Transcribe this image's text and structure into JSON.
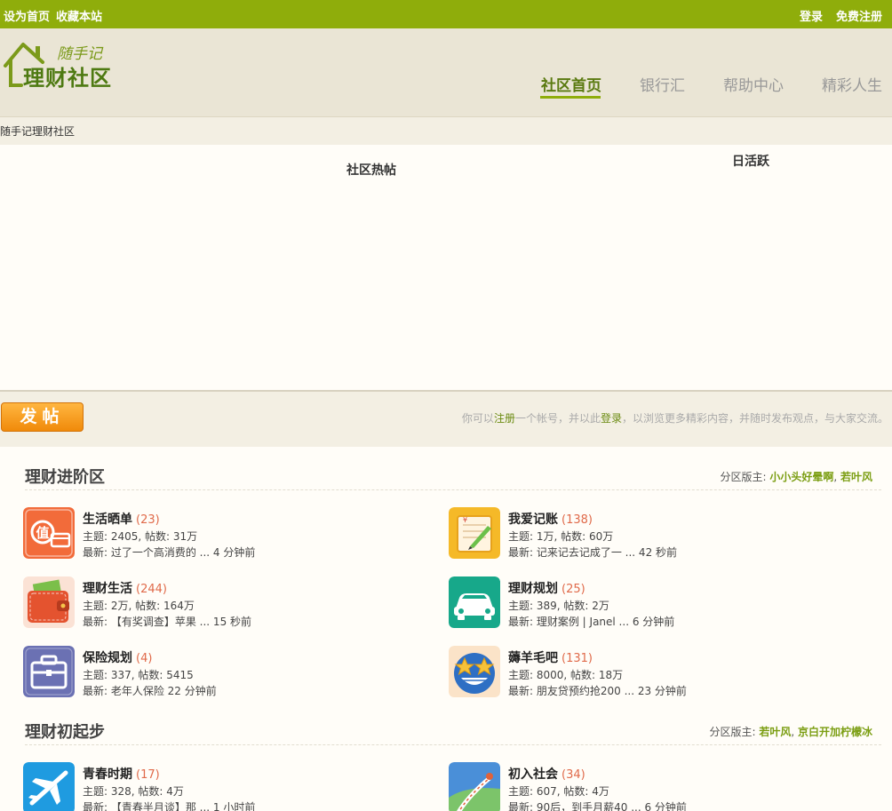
{
  "topbar": {
    "set_home": "设为首页",
    "bookmark": "收藏本站",
    "login": "登录",
    "register": "免费注册"
  },
  "logo": {
    "script": "随手记",
    "main": "理财社区"
  },
  "nav": {
    "home": "社区首页",
    "bank": "银行汇",
    "help": "帮助中心",
    "life": "精彩人生"
  },
  "breadcrumb": "随手记理财社区",
  "panels": {
    "hot": "社区热帖",
    "daily": "日活跃"
  },
  "post": {
    "button": "发帖",
    "notice_pre": "你可以",
    "notice_register": "注册",
    "notice_mid": "一个帐号，并以此",
    "notice_login": "登录",
    "notice_post": "，以浏览更多精彩内容，并随时发布观点，与大家交流。"
  },
  "sections": [
    {
      "title": "理财进阶区",
      "mod_label": "分区版主: ",
      "mod1": "小小头好晕啊",
      "mod_sep": ", ",
      "mod2": "若叶风",
      "forums": [
        {
          "name": "生活晒单",
          "count": "(23)",
          "stats": "主题: 2405, 帖数: 31万",
          "latest": "最新: 过了一个高消费的 ... 4 分钟前"
        },
        {
          "name": "我爱记账",
          "count": "(138)",
          "stats": "主题: 1万, 帖数: 60万",
          "latest": "最新: 记来记去记成了一 ... 42 秒前"
        },
        {
          "name": "理财生活",
          "count": "(244)",
          "stats": "主题: 2万, 帖数: 164万",
          "latest": "最新: 【有奖调查】苹果 ... 15 秒前"
        },
        {
          "name": "理财规划",
          "count": "(25)",
          "stats": "主题: 389, 帖数: 2万",
          "latest": "最新: 理财案例 | Janel ... 6 分钟前"
        },
        {
          "name": "保险规划",
          "count": "(4)",
          "stats": "主题: 337, 帖数: 5415",
          "latest": "最新: 老年人保险  22 分钟前"
        },
        {
          "name": "薅羊毛吧",
          "count": "(131)",
          "stats": "主题: 8000, 帖数: 18万",
          "latest": "最新: 朋友贷预约抢200 ... 23 分钟前"
        }
      ]
    },
    {
      "title": "理财初起步",
      "mod_label": "分区版主: ",
      "mod1": "若叶风",
      "mod_sep": ", ",
      "mod2": "京白开加柠檬冰",
      "forums": [
        {
          "name": "青春时期",
          "count": "(17)",
          "stats": "主题: 328, 帖数: 4万",
          "latest": "最新: 【青春半月谈】那 ... 1 小时前"
        },
        {
          "name": "初入社会",
          "count": "(34)",
          "stats": "主题: 607, 帖数: 4万",
          "latest": "最新: 90后，到手月薪40 ... 6 分钟前"
        }
      ]
    }
  ]
}
